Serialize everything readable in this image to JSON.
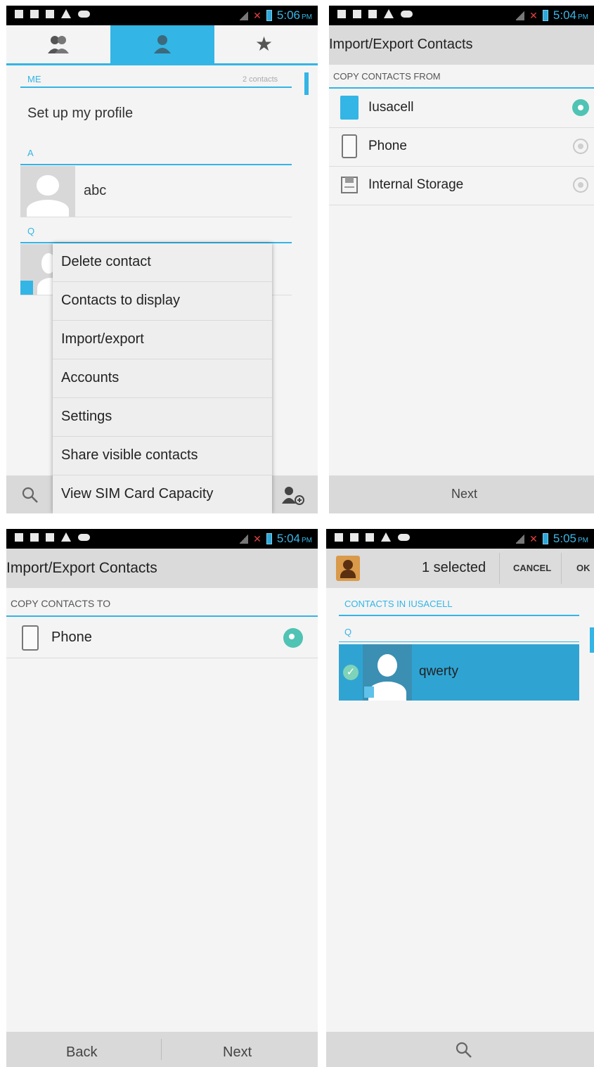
{
  "screen1": {
    "status_time": "5:06",
    "status_ampm": "PM",
    "tabs": [
      "groups-icon",
      "person-icon",
      "star-icon"
    ],
    "me_header": "ME",
    "contacts_count": "2 contacts",
    "profile_label": "Set up my profile",
    "section_a": "A",
    "contact_abc": "abc",
    "section_q": "Q",
    "menu_items": [
      "Delete contact",
      "Contacts to display",
      "Import/export",
      "Accounts",
      "Settings",
      "Share visible contacts",
      "View SIM Card Capacity"
    ]
  },
  "screen2": {
    "status_time": "5:04",
    "status_ampm": "PM",
    "title": "Import/Export Contacts",
    "header": "COPY CONTACTS FROM",
    "sources": [
      "Iusacell",
      "Phone",
      "Internal Storage"
    ],
    "selected_index": 0,
    "next_label": "Next"
  },
  "screen3": {
    "status_time": "5:04",
    "status_ampm": "PM",
    "title": "Import/Export Contacts",
    "header": "COPY CONTACTS TO",
    "target": "Phone",
    "back_label": "Back",
    "next_label": "Next"
  },
  "screen4": {
    "status_time": "5:05",
    "status_ampm": "PM",
    "selected_label": "1 selected",
    "cancel_label": "CANCEL",
    "ok_label": "OK",
    "header": "CONTACTS IN IUSACELL",
    "section_q": "Q",
    "contact_name": "qwerty"
  },
  "colors": {
    "accent": "#33b5e5",
    "radio_selected": "#4fc3b4",
    "selection_bg": "#2fa4d3"
  }
}
